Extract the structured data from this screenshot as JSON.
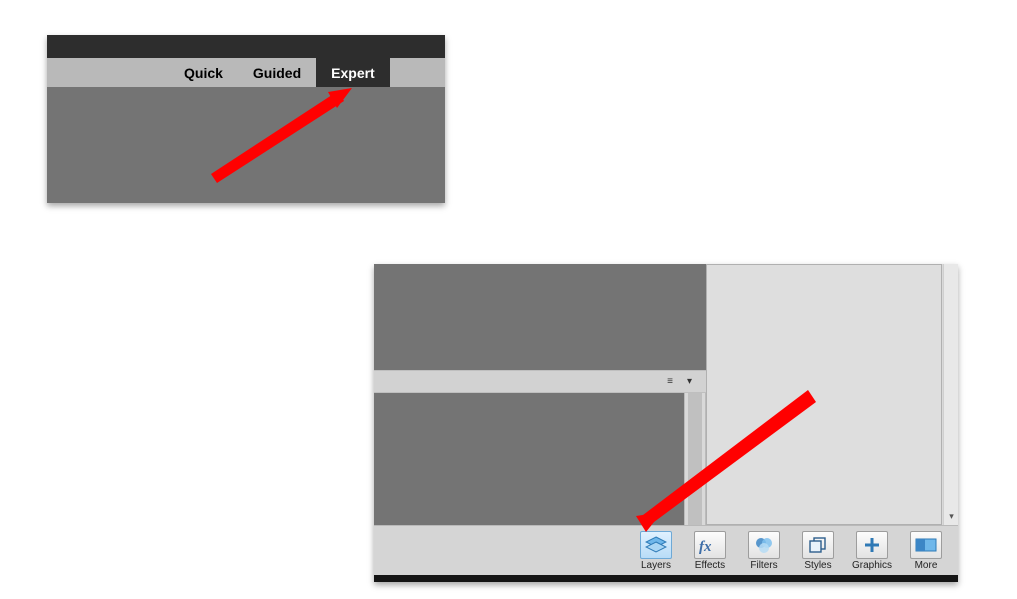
{
  "tabs": {
    "items": [
      {
        "label": "Quick",
        "active": false
      },
      {
        "label": "Guided",
        "active": false
      },
      {
        "label": "Expert",
        "active": true
      }
    ]
  },
  "toolbar": {
    "items": [
      {
        "label": "Layers",
        "active": true
      },
      {
        "label": "Effects",
        "active": false
      },
      {
        "label": "Filters",
        "active": false
      },
      {
        "label": "Styles",
        "active": false
      },
      {
        "label": "Graphics",
        "active": false
      },
      {
        "label": "More",
        "active": false
      }
    ]
  },
  "optionbar": {
    "list_glyph": "≡",
    "dropdown_glyph": "▾"
  }
}
